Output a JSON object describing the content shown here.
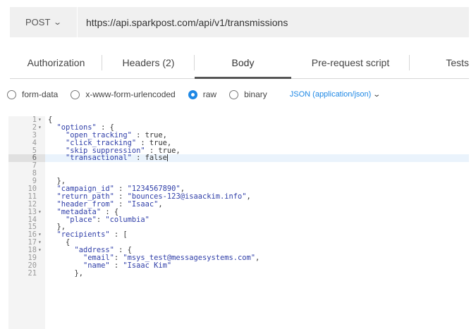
{
  "request": {
    "method": "POST",
    "url": "https://api.sparkpost.com/api/v1/transmissions"
  },
  "tabs": [
    {
      "label": "Authorization",
      "active": false
    },
    {
      "label": "Headers (2)",
      "active": false
    },
    {
      "label": "Body",
      "active": true
    },
    {
      "label": "Pre-request script",
      "active": false
    },
    {
      "label": "Tests",
      "active": false
    }
  ],
  "body_types": [
    {
      "label": "form-data",
      "selected": false
    },
    {
      "label": "x-www-form-urlencoded",
      "selected": false
    },
    {
      "label": "raw",
      "selected": true
    },
    {
      "label": "binary",
      "selected": false
    }
  ],
  "content_type": "JSON (application/json)",
  "editor": {
    "highlighted_line": 6,
    "lines": [
      {
        "n": "1",
        "fold": true,
        "text": "{"
      },
      {
        "n": "2",
        "fold": true,
        "text": "  \"options\" : {"
      },
      {
        "n": "3",
        "fold": false,
        "text": "    \"open_tracking\" : true,"
      },
      {
        "n": "4",
        "fold": false,
        "text": "    \"click_tracking\" : true,"
      },
      {
        "n": "5",
        "fold": false,
        "text": "    \"skip_suppression\" : true,"
      },
      {
        "n": "6",
        "fold": false,
        "text": "    \"transactional\" : false"
      },
      {
        "n": "7",
        "fold": false,
        "text": ""
      },
      {
        "n": "8",
        "fold": false,
        "text": ""
      },
      {
        "n": "9",
        "fold": false,
        "text": "  },"
      },
      {
        "n": "10",
        "fold": false,
        "text": "  \"campaign_id\" : \"1234567890\","
      },
      {
        "n": "11",
        "fold": false,
        "text": "  \"return_path\" : \"bounces-123@isaackim.info\","
      },
      {
        "n": "12",
        "fold": false,
        "text": "  \"header_from\" : \"Isaac\","
      },
      {
        "n": "13",
        "fold": true,
        "text": "  \"metadata\" : {"
      },
      {
        "n": "14",
        "fold": false,
        "text": "    \"place\": \"columbia\""
      },
      {
        "n": "15",
        "fold": false,
        "text": "  },"
      },
      {
        "n": "16",
        "fold": true,
        "text": "  \"recipients\" : ["
      },
      {
        "n": "17",
        "fold": true,
        "text": "    {"
      },
      {
        "n": "18",
        "fold": true,
        "text": "      \"address\" : {"
      },
      {
        "n": "19",
        "fold": false,
        "text": "        \"email\": \"msys_test@messagesystems.com\","
      },
      {
        "n": "20",
        "fold": false,
        "text": "        \"name\" : \"Isaac Kim\""
      },
      {
        "n": "21",
        "fold": false,
        "text": "      },"
      }
    ]
  },
  "icons": {
    "method_dropdown": "chevron-down-icon",
    "content_type_dropdown": "chevron-down-icon",
    "fold": "fold-arrow-icon"
  },
  "colors": {
    "accent": "#1e88e5",
    "string": "#2f3ea8",
    "highlight_line": "#eaf3fc"
  }
}
